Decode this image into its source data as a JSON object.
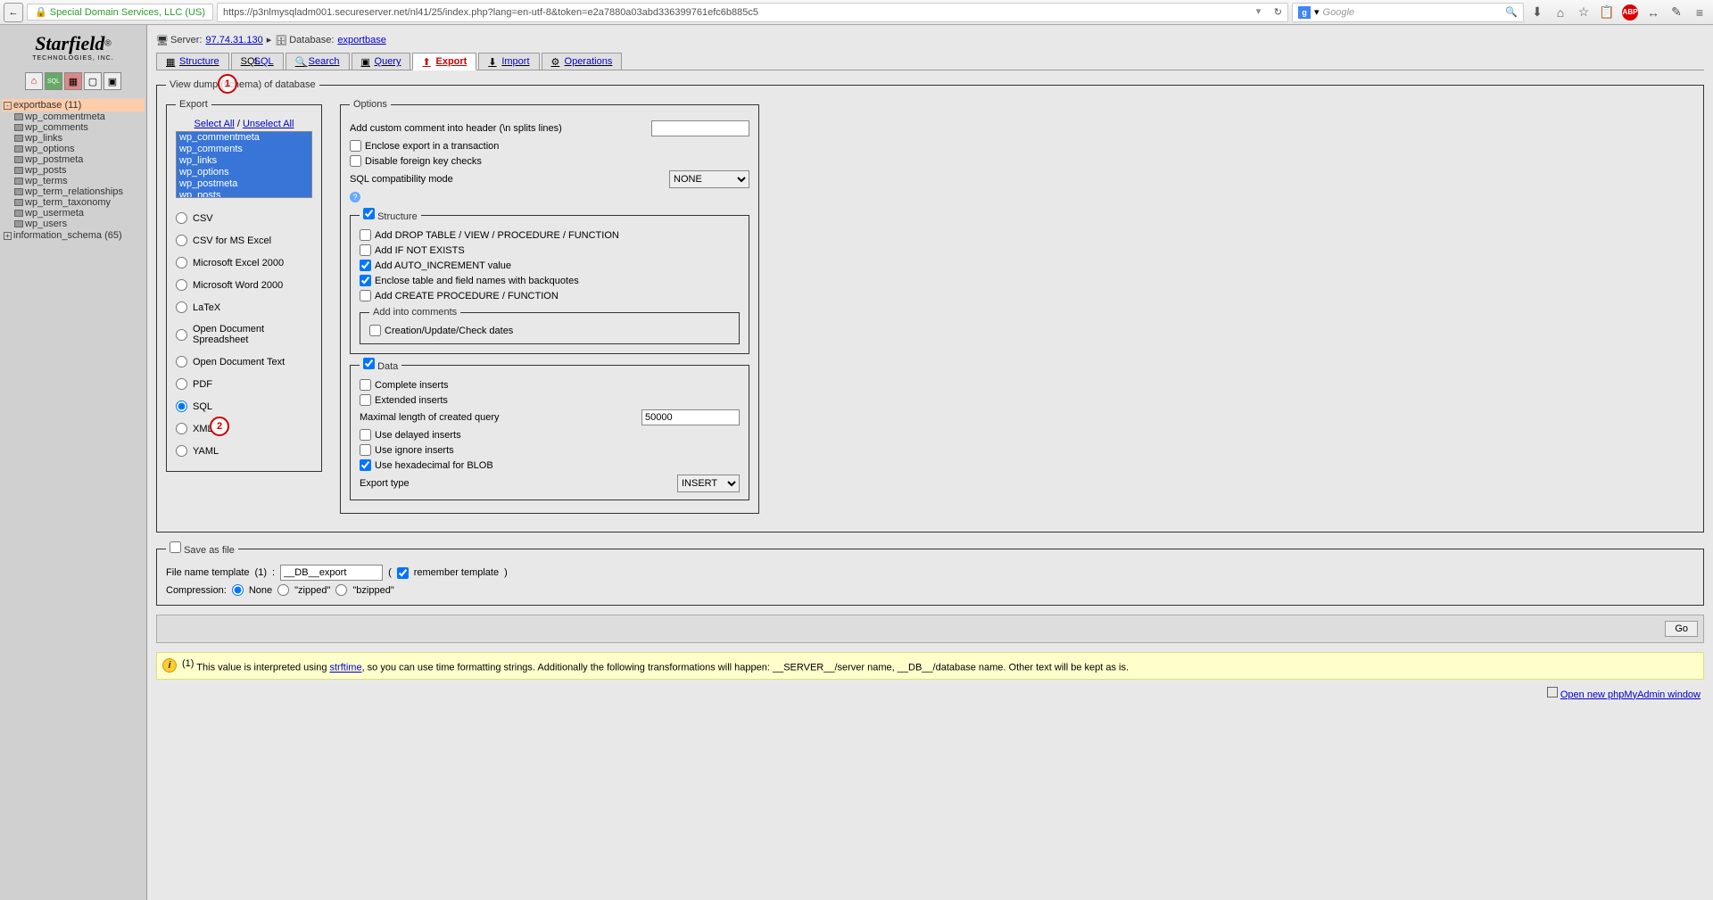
{
  "browser": {
    "back": "←",
    "sslOwner": "Special Domain Services, LLC (US)",
    "url": "https://p3nlmysqladm001.secureserver.net/nl41/25/index.php?lang=en-utf-8&token=e2a7880a03abd336399761efc6b885c5",
    "searchPlaceholder": "Google"
  },
  "sidebar": {
    "logoMain": "Starfield",
    "logoReg": "®",
    "logoSub": "TECHNOLOGIES, INC.",
    "databases": [
      {
        "name": "exportbase (11)",
        "active": true
      },
      {
        "name": "information_schema (65)",
        "active": false
      }
    ],
    "tables": [
      "wp_commentmeta",
      "wp_comments",
      "wp_links",
      "wp_options",
      "wp_postmeta",
      "wp_posts",
      "wp_terms",
      "wp_term_relationships",
      "wp_term_taxonomy",
      "wp_usermeta",
      "wp_users"
    ]
  },
  "breadcrumb": {
    "serverLabel": "Server:",
    "serverVal": "97.74.31.130",
    "sep": "▸",
    "dbLabel": "Database:",
    "dbVal": "exportbase"
  },
  "tabs": [
    "Structure",
    "SQL",
    "Search",
    "Query",
    "Export",
    "Import",
    "Operations"
  ],
  "activeTab": "Export",
  "fieldsets": {
    "main": "View dump (schema) of database",
    "export": "Export",
    "options": "Options",
    "structure": "Structure",
    "comments": "Add into comments",
    "data": "Data",
    "save": "Save as file"
  },
  "export": {
    "selectAll": "Select All",
    "unselectAll": "Unselect All",
    "slash": " / ",
    "tables": [
      "wp_commentmeta",
      "wp_comments",
      "wp_links",
      "wp_options",
      "wp_postmeta",
      "wp_posts"
    ],
    "formats": [
      "CSV",
      "CSV for MS Excel",
      "Microsoft Excel 2000",
      "Microsoft Word 2000",
      "LaTeX",
      "Open Document Spreadsheet",
      "Open Document Text",
      "PDF",
      "SQL",
      "XML",
      "YAML"
    ],
    "selectedFormat": "SQL"
  },
  "options": {
    "customCommentLabel": "Add custom comment into header (\\n splits lines)",
    "customCommentVal": "",
    "encloseTransaction": "Enclose export in a transaction",
    "disableFK": "Disable foreign key checks",
    "sqlCompatLabel": "SQL compatibility mode",
    "sqlCompatVal": "NONE"
  },
  "structure": {
    "addDrop": "Add DROP TABLE / VIEW / PROCEDURE / FUNCTION",
    "addIfNotExists": "Add IF NOT EXISTS",
    "addAutoInc": "Add AUTO_INCREMENT value",
    "encloseBackquote": "Enclose table and field names with backquotes",
    "addCreateProc": "Add CREATE PROCEDURE / FUNCTION",
    "creationDates": "Creation/Update/Check dates"
  },
  "data": {
    "completeInserts": "Complete inserts",
    "extendedInserts": "Extended inserts",
    "maxLengthLabel": "Maximal length of created query",
    "maxLengthVal": "50000",
    "useDelayed": "Use delayed inserts",
    "useIgnore": "Use ignore inserts",
    "useHex": "Use hexadecimal for BLOB",
    "exportTypeLabel": "Export type",
    "exportTypeVal": "INSERT"
  },
  "save": {
    "fileNameLabel": "File name template",
    "sup": "(1)",
    "colon": ":",
    "fileNameVal": "__DB__export",
    "rememberOpen": "(",
    "rememberLabel": "remember template",
    "rememberClose": ")",
    "compressionLabel": "Compression:",
    "compNone": "None",
    "compZipped": "\"zipped\"",
    "compBzipped": "\"bzipped\""
  },
  "goLabel": "Go",
  "note": {
    "sup": "(1)",
    "t1": " This value is interpreted using ",
    "link": "strftime",
    "t2": ", so you can use time formatting strings. Additionally the following transformations will happen: __SERVER__/server name, __DB__/database name. Other text will be kept as is."
  },
  "footer": {
    "link": "Open new phpMyAdmin window"
  },
  "annotations": {
    "a1": "1",
    "a2": "2"
  }
}
